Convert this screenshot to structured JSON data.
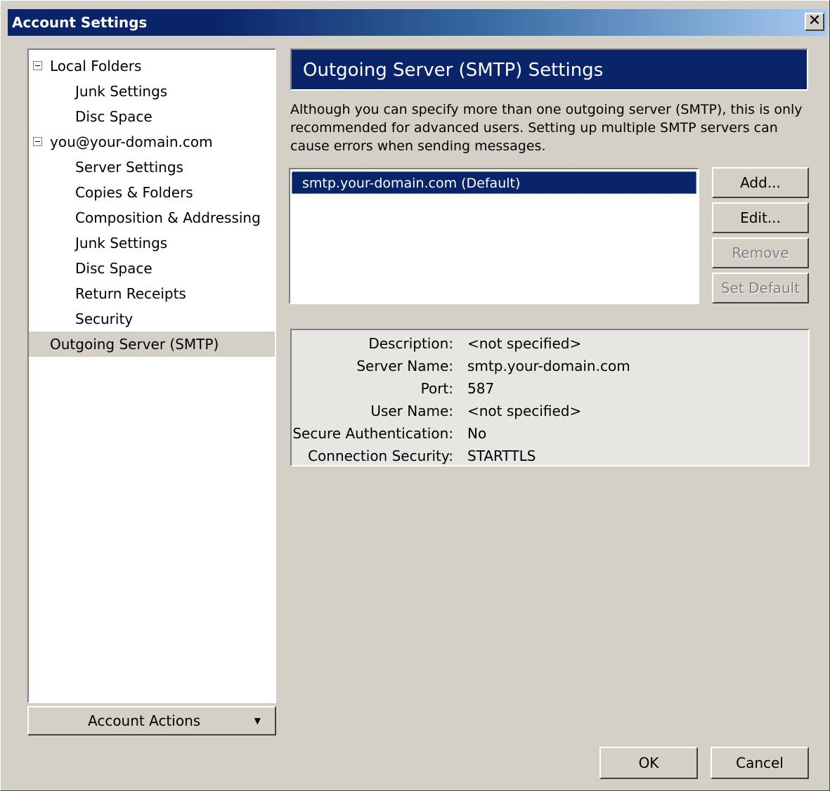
{
  "window": {
    "title": "Account Settings",
    "close_glyph": "✕"
  },
  "tree": {
    "items": [
      {
        "label": "Local Folders",
        "level": 0,
        "expanded": true
      },
      {
        "label": "Junk Settings",
        "level": 1
      },
      {
        "label": "Disc Space",
        "level": 1
      },
      {
        "label": "you@your-domain.com",
        "level": 0,
        "expanded": true
      },
      {
        "label": "Server Settings",
        "level": 1
      },
      {
        "label": "Copies & Folders",
        "level": 1
      },
      {
        "label": "Composition & Addressing",
        "level": 1
      },
      {
        "label": "Junk Settings",
        "level": 1
      },
      {
        "label": "Disc Space",
        "level": 1
      },
      {
        "label": "Return Receipts",
        "level": 1
      },
      {
        "label": "Security",
        "level": 1
      },
      {
        "label": "Outgoing Server (SMTP)",
        "level": 0,
        "selected": true
      }
    ]
  },
  "account_actions": {
    "label": "Account Actions",
    "arrow": "▼"
  },
  "panel": {
    "title": "Outgoing Server (SMTP) Settings",
    "description": "Although you can specify more than one outgoing server (SMTP), this is only recommended for advanced users. Setting up multiple SMTP servers can cause errors when sending messages.",
    "servers": [
      "smtp.your-domain.com (Default)"
    ],
    "buttons": {
      "add": "Add...",
      "edit": "Edit...",
      "remove": "Remove",
      "set_default": "Set Default"
    },
    "details": [
      {
        "key": "Description:",
        "value": "<not specified>"
      },
      {
        "key": "Server Name:",
        "value": "smtp.your-domain.com"
      },
      {
        "key": "Port:",
        "value": "587"
      },
      {
        "key": "User Name:",
        "value": "<not specified>"
      },
      {
        "key": "Secure Authentication:",
        "value": "No"
      },
      {
        "key": "Connection Security:",
        "value": "STARTTLS"
      }
    ]
  },
  "footer": {
    "ok": "OK",
    "cancel": "Cancel"
  },
  "colors": {
    "title_bar": "#0a246a",
    "selection": "#0a246a",
    "face": "#d4d0c8"
  }
}
